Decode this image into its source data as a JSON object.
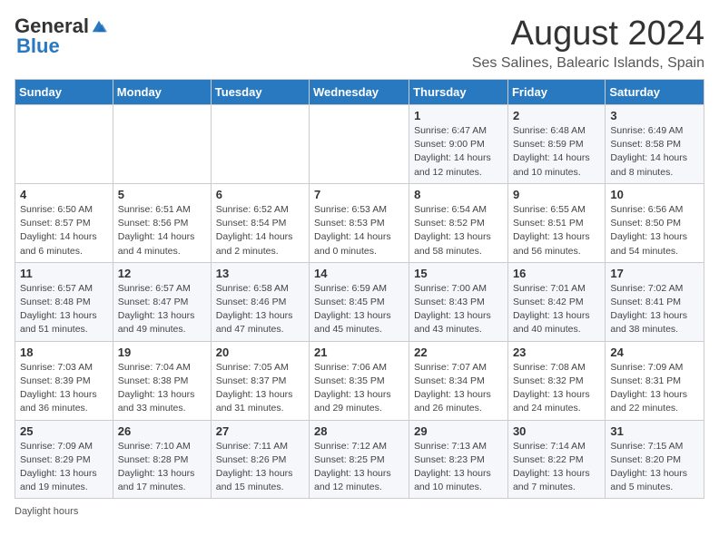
{
  "logo": {
    "general": "General",
    "blue": "Blue"
  },
  "title": "August 2024",
  "location": "Ses Salines, Balearic Islands, Spain",
  "days_of_week": [
    "Sunday",
    "Monday",
    "Tuesday",
    "Wednesday",
    "Thursday",
    "Friday",
    "Saturday"
  ],
  "footer": "Daylight hours",
  "weeks": [
    [
      {
        "day": "",
        "info": ""
      },
      {
        "day": "",
        "info": ""
      },
      {
        "day": "",
        "info": ""
      },
      {
        "day": "",
        "info": ""
      },
      {
        "day": "1",
        "info": "Sunrise: 6:47 AM\nSunset: 9:00 PM\nDaylight: 14 hours\nand 12 minutes."
      },
      {
        "day": "2",
        "info": "Sunrise: 6:48 AM\nSunset: 8:59 PM\nDaylight: 14 hours\nand 10 minutes."
      },
      {
        "day": "3",
        "info": "Sunrise: 6:49 AM\nSunset: 8:58 PM\nDaylight: 14 hours\nand 8 minutes."
      }
    ],
    [
      {
        "day": "4",
        "info": "Sunrise: 6:50 AM\nSunset: 8:57 PM\nDaylight: 14 hours\nand 6 minutes."
      },
      {
        "day": "5",
        "info": "Sunrise: 6:51 AM\nSunset: 8:56 PM\nDaylight: 14 hours\nand 4 minutes."
      },
      {
        "day": "6",
        "info": "Sunrise: 6:52 AM\nSunset: 8:54 PM\nDaylight: 14 hours\nand 2 minutes."
      },
      {
        "day": "7",
        "info": "Sunrise: 6:53 AM\nSunset: 8:53 PM\nDaylight: 14 hours\nand 0 minutes."
      },
      {
        "day": "8",
        "info": "Sunrise: 6:54 AM\nSunset: 8:52 PM\nDaylight: 13 hours\nand 58 minutes."
      },
      {
        "day": "9",
        "info": "Sunrise: 6:55 AM\nSunset: 8:51 PM\nDaylight: 13 hours\nand 56 minutes."
      },
      {
        "day": "10",
        "info": "Sunrise: 6:56 AM\nSunset: 8:50 PM\nDaylight: 13 hours\nand 54 minutes."
      }
    ],
    [
      {
        "day": "11",
        "info": "Sunrise: 6:57 AM\nSunset: 8:48 PM\nDaylight: 13 hours\nand 51 minutes."
      },
      {
        "day": "12",
        "info": "Sunrise: 6:57 AM\nSunset: 8:47 PM\nDaylight: 13 hours\nand 49 minutes."
      },
      {
        "day": "13",
        "info": "Sunrise: 6:58 AM\nSunset: 8:46 PM\nDaylight: 13 hours\nand 47 minutes."
      },
      {
        "day": "14",
        "info": "Sunrise: 6:59 AM\nSunset: 8:45 PM\nDaylight: 13 hours\nand 45 minutes."
      },
      {
        "day": "15",
        "info": "Sunrise: 7:00 AM\nSunset: 8:43 PM\nDaylight: 13 hours\nand 43 minutes."
      },
      {
        "day": "16",
        "info": "Sunrise: 7:01 AM\nSunset: 8:42 PM\nDaylight: 13 hours\nand 40 minutes."
      },
      {
        "day": "17",
        "info": "Sunrise: 7:02 AM\nSunset: 8:41 PM\nDaylight: 13 hours\nand 38 minutes."
      }
    ],
    [
      {
        "day": "18",
        "info": "Sunrise: 7:03 AM\nSunset: 8:39 PM\nDaylight: 13 hours\nand 36 minutes."
      },
      {
        "day": "19",
        "info": "Sunrise: 7:04 AM\nSunset: 8:38 PM\nDaylight: 13 hours\nand 33 minutes."
      },
      {
        "day": "20",
        "info": "Sunrise: 7:05 AM\nSunset: 8:37 PM\nDaylight: 13 hours\nand 31 minutes."
      },
      {
        "day": "21",
        "info": "Sunrise: 7:06 AM\nSunset: 8:35 PM\nDaylight: 13 hours\nand 29 minutes."
      },
      {
        "day": "22",
        "info": "Sunrise: 7:07 AM\nSunset: 8:34 PM\nDaylight: 13 hours\nand 26 minutes."
      },
      {
        "day": "23",
        "info": "Sunrise: 7:08 AM\nSunset: 8:32 PM\nDaylight: 13 hours\nand 24 minutes."
      },
      {
        "day": "24",
        "info": "Sunrise: 7:09 AM\nSunset: 8:31 PM\nDaylight: 13 hours\nand 22 minutes."
      }
    ],
    [
      {
        "day": "25",
        "info": "Sunrise: 7:09 AM\nSunset: 8:29 PM\nDaylight: 13 hours\nand 19 minutes."
      },
      {
        "day": "26",
        "info": "Sunrise: 7:10 AM\nSunset: 8:28 PM\nDaylight: 13 hours\nand 17 minutes."
      },
      {
        "day": "27",
        "info": "Sunrise: 7:11 AM\nSunset: 8:26 PM\nDaylight: 13 hours\nand 15 minutes."
      },
      {
        "day": "28",
        "info": "Sunrise: 7:12 AM\nSunset: 8:25 PM\nDaylight: 13 hours\nand 12 minutes."
      },
      {
        "day": "29",
        "info": "Sunrise: 7:13 AM\nSunset: 8:23 PM\nDaylight: 13 hours\nand 10 minutes."
      },
      {
        "day": "30",
        "info": "Sunrise: 7:14 AM\nSunset: 8:22 PM\nDaylight: 13 hours\nand 7 minutes."
      },
      {
        "day": "31",
        "info": "Sunrise: 7:15 AM\nSunset: 8:20 PM\nDaylight: 13 hours\nand 5 minutes."
      }
    ]
  ]
}
